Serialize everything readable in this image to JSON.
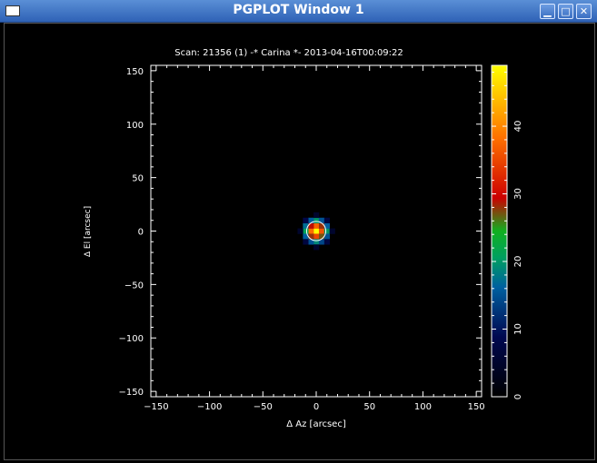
{
  "window": {
    "title": "PGPLOT Window 1",
    "minimize_glyph": "▁",
    "maximize_glyph": "□",
    "close_glyph": "✕"
  },
  "plot": {
    "title": "Scan: 21356 (1) -* Carina *- 2013-04-16T00:09:22",
    "xlabel": "Δ Az [arcsec]",
    "ylabel": "Δ El [arcsec]",
    "background": "#000000",
    "axis_color": "#ffffff"
  },
  "chart_data": {
    "type": "heatmap",
    "title": "Scan: 21356 (1) -* Carina *- 2013-04-16T00:09:22",
    "xlabel": "Δ Az [arcsec]",
    "ylabel": "Δ El [arcsec]",
    "xlim": [
      -155,
      155
    ],
    "ylim": [
      -155,
      155
    ],
    "xticks": [
      -150,
      -100,
      -50,
      0,
      50,
      100,
      150
    ],
    "yticks": [
      -150,
      -100,
      -50,
      0,
      50,
      100,
      150
    ],
    "colorbar": {
      "min": 0,
      "max": 49,
      "ticks": [
        0,
        10,
        20,
        30,
        40
      ]
    },
    "source_center_arcsec": [
      0,
      0
    ],
    "source_circle_radius_arcsec": 9,
    "pixels": [
      {
        "az": 0,
        "el": 0,
        "value": 49
      },
      {
        "az": -5,
        "el": 0,
        "value": 38
      },
      {
        "az": 5,
        "el": 0,
        "value": 36
      },
      {
        "az": 0,
        "el": 5,
        "value": 37
      },
      {
        "az": 0,
        "el": -5,
        "value": 35
      },
      {
        "az": -5,
        "el": 5,
        "value": 29
      },
      {
        "az": 5,
        "el": 5,
        "value": 28
      },
      {
        "az": -5,
        "el": -5,
        "value": 28
      },
      {
        "az": 5,
        "el": -5,
        "value": 27
      },
      {
        "az": -10,
        "el": 0,
        "value": 21
      },
      {
        "az": 10,
        "el": 0,
        "value": 20
      },
      {
        "az": 0,
        "el": 10,
        "value": 20
      },
      {
        "az": 0,
        "el": -10,
        "value": 19
      },
      {
        "az": -10,
        "el": 5,
        "value": 17
      },
      {
        "az": 10,
        "el": 5,
        "value": 16
      },
      {
        "az": -10,
        "el": -5,
        "value": 16
      },
      {
        "az": 10,
        "el": -5,
        "value": 15
      },
      {
        "az": -5,
        "el": 10,
        "value": 16
      },
      {
        "az": 5,
        "el": 10,
        "value": 15
      },
      {
        "az": -5,
        "el": -10,
        "value": 15
      },
      {
        "az": 5,
        "el": -10,
        "value": 14
      },
      {
        "az": -10,
        "el": 10,
        "value": 8
      },
      {
        "az": 10,
        "el": 10,
        "value": 7
      },
      {
        "az": -10,
        "el": -10,
        "value": 7
      },
      {
        "az": 10,
        "el": -10,
        "value": 7
      },
      {
        "az": -15,
        "el": 0,
        "value": 5
      },
      {
        "az": 15,
        "el": 0,
        "value": 5
      },
      {
        "az": 0,
        "el": 15,
        "value": 5
      },
      {
        "az": 0,
        "el": -15,
        "value": 5
      }
    ]
  }
}
